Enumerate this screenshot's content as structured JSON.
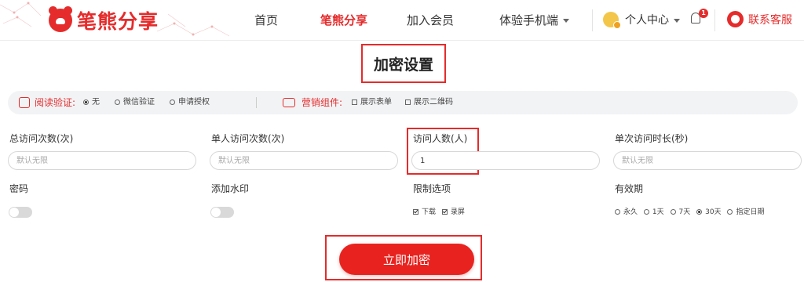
{
  "header": {
    "logo_text": "笔熊分享",
    "nav": [
      {
        "label": "首页"
      },
      {
        "label": "笔熊分享"
      },
      {
        "label": "加入会员"
      },
      {
        "label": "体验手机端"
      }
    ],
    "user_center": "个人中心",
    "notification_count": "1",
    "customer_service": "联系客服",
    "accent_color": "#e52b2b"
  },
  "page": {
    "title": "加密设置"
  },
  "options_bar": {
    "read_verify_label": "阅读验证:",
    "read_verify_options": [
      {
        "label": "无",
        "selected": true
      },
      {
        "label": "微信验证",
        "selected": false
      },
      {
        "label": "申请授权",
        "selected": false
      }
    ],
    "marketing_label": "营销组件:",
    "marketing_options": [
      {
        "label": "展示表单",
        "checked": false
      },
      {
        "label": "展示二维码",
        "checked": false
      }
    ]
  },
  "fields": {
    "total_visits": {
      "label": "总访问次数(次)",
      "placeholder": "默认无限",
      "value": ""
    },
    "single_visits": {
      "label": "单人访问次数(次)",
      "placeholder": "默认无限",
      "value": ""
    },
    "visitors": {
      "label": "访问人数(人)",
      "placeholder": "",
      "value": "1"
    },
    "duration": {
      "label": "单次访问时长(秒)",
      "placeholder": "默认无限",
      "value": ""
    },
    "password": {
      "label": "密码",
      "enabled": false
    },
    "watermark": {
      "label": "添加水印",
      "enabled": false
    },
    "limits": {
      "label": "限制选项",
      "options": [
        {
          "label": "下载",
          "checked": true
        },
        {
          "label": "录屏",
          "checked": true
        }
      ]
    },
    "validity": {
      "label": "有效期",
      "options": [
        {
          "label": "永久",
          "selected": false
        },
        {
          "label": "1天",
          "selected": false
        },
        {
          "label": "7天",
          "selected": false
        },
        {
          "label": "30天",
          "selected": true
        },
        {
          "label": "指定日期",
          "selected": false
        }
      ]
    }
  },
  "submit": {
    "label": "立即加密"
  }
}
